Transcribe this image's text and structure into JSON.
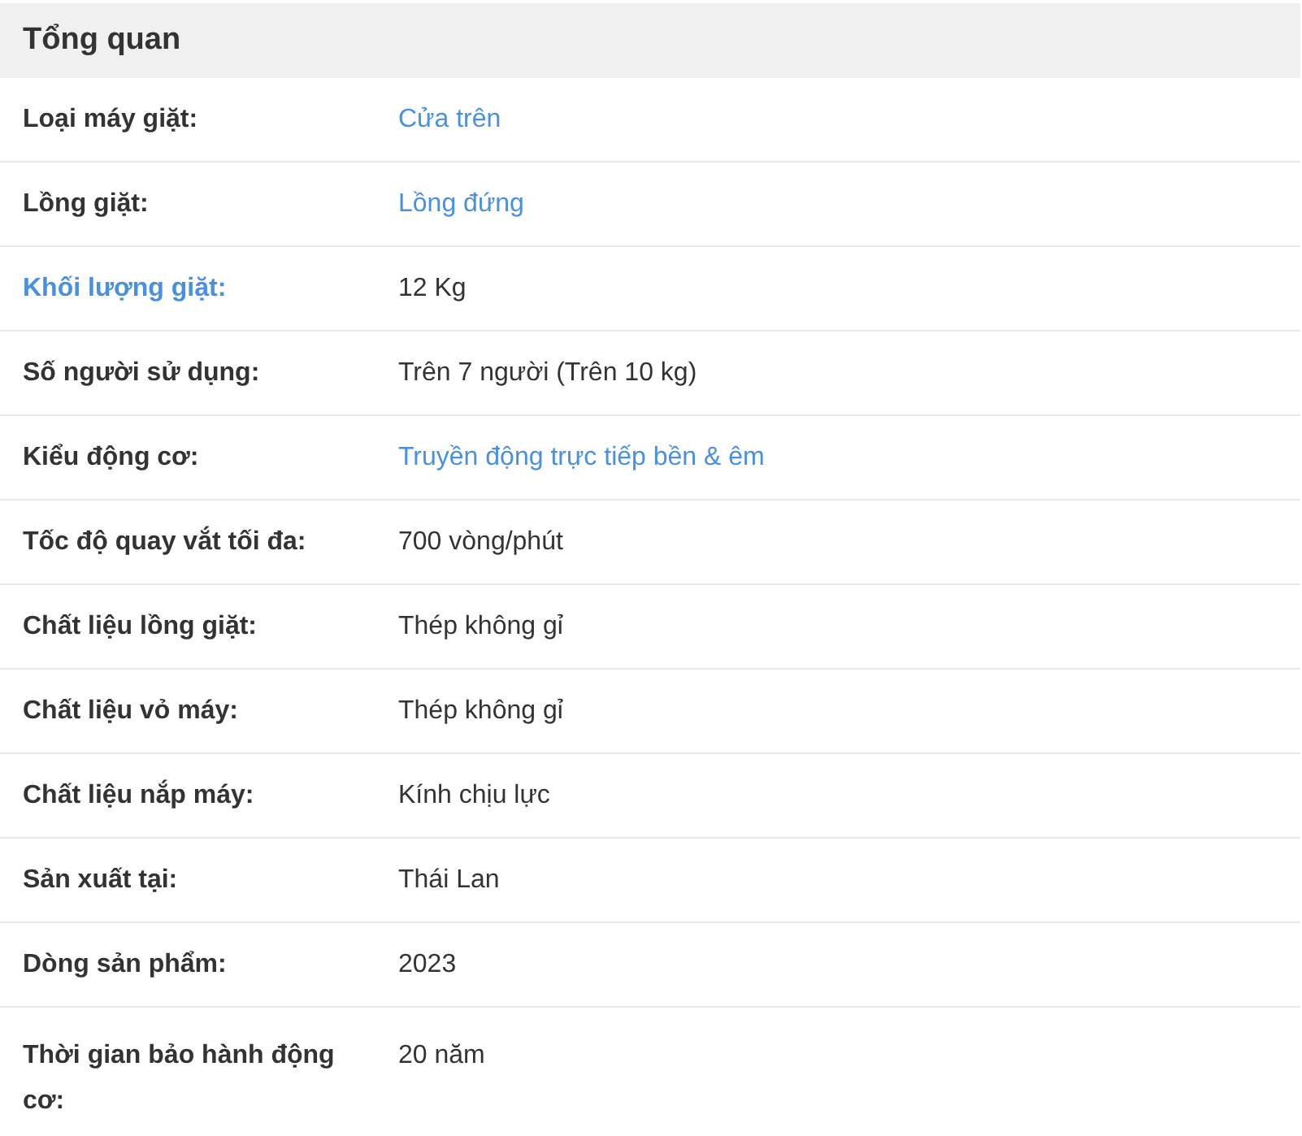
{
  "section": {
    "title": "Tổng quan"
  },
  "rows": [
    {
      "label": "Loại máy giặt:",
      "label_link": false,
      "value": "Cửa trên",
      "value_link": true
    },
    {
      "label": "Lồng giặt:",
      "label_link": false,
      "value": "Lồng đứng",
      "value_link": true
    },
    {
      "label": "Khối lượng giặt:",
      "label_link": true,
      "value": "12 Kg",
      "value_link": false
    },
    {
      "label": "Số người sử dụng:",
      "label_link": false,
      "value": "Trên 7 người (Trên 10 kg)",
      "value_link": false
    },
    {
      "label": "Kiểu động cơ:",
      "label_link": false,
      "value": "Truyền động trực tiếp bền & êm",
      "value_link": true
    },
    {
      "label": "Tốc độ quay vắt tối đa:",
      "label_link": false,
      "value": "700 vòng/phút",
      "value_link": false
    },
    {
      "label": "Chất liệu lồng giặt:",
      "label_link": false,
      "value": "Thép không gỉ",
      "value_link": false
    },
    {
      "label": "Chất liệu vỏ máy:",
      "label_link": false,
      "value": "Thép không gỉ",
      "value_link": false
    },
    {
      "label": "Chất liệu nắp máy:",
      "label_link": false,
      "value": "Kính chịu lực",
      "value_link": false
    },
    {
      "label": "Sản xuất tại:",
      "label_link": false,
      "value": "Thái Lan",
      "value_link": false
    },
    {
      "label": "Dòng sản phẩm:",
      "label_link": false,
      "value": "2023",
      "value_link": false
    },
    {
      "label": "Thời gian bảo hành động cơ:",
      "label_link": false,
      "value": "20 năm",
      "value_link": false
    }
  ]
}
